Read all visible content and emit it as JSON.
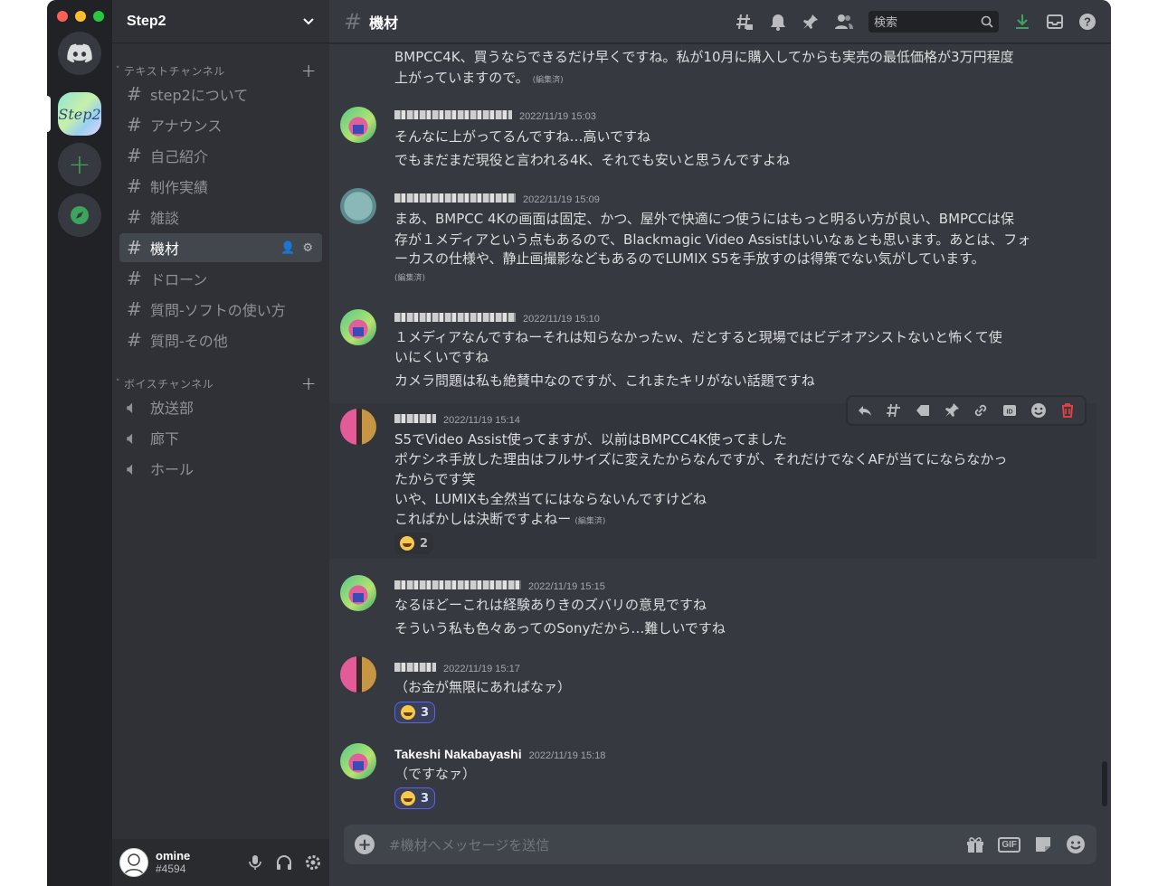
{
  "app": {
    "server_name": "Step2",
    "server_icon_text": "Step2"
  },
  "categories": {
    "text": "テキストチャンネル",
    "voice": "ボイスチャンネル"
  },
  "channels": [
    {
      "name": "step2について"
    },
    {
      "name": "アナウンス"
    },
    {
      "name": "自己紹介"
    },
    {
      "name": "制作実績"
    },
    {
      "name": "雑談"
    },
    {
      "name": "機材"
    },
    {
      "name": "ドローン"
    },
    {
      "name": "質問-ソフトの使い方"
    },
    {
      "name": "質問-その他"
    }
  ],
  "voice_channels": [
    {
      "name": "放送部"
    },
    {
      "name": "廊下"
    },
    {
      "name": "ホール"
    }
  ],
  "user": {
    "name": "omine",
    "tag": "#4594"
  },
  "topbar": {
    "channel": "機材",
    "search_placeholder": "検索"
  },
  "messages": [
    {
      "lines": [
        "BMPCC4K、買うならできるだけ早くですね。私が10月に購入してからも実売の最低価格が3万円程度",
        "上がっていますので。"
      ],
      "edited": "(編集済)"
    },
    {
      "time": "2022/11/19 15:03",
      "lines": [
        "そんなに上がってるんですね…高いですね",
        "でもまだまだ現役と言われる4K、それでも安いと思うんですよね"
      ]
    },
    {
      "time": "2022/11/19 15:09",
      "lines": [
        "まあ、BMPCC 4Kの画面は固定、かつ、屋外で快適につ使うにはもっと明るい方が良い、BMPCCは保",
        "存が１メディアという点もあるので、Blackmagic Video Assistはいいなぁとも思います。あとは、フォ",
        "ーカスの仕様や、静止画撮影などもあるのでLUMIX S5を手放すのは得策でない気がしています。"
      ],
      "edited": "(編集済)"
    },
    {
      "time": "2022/11/19 15:10",
      "lines": [
        "１メディアなんですねーそれは知らなかったｗ、だとすると現場ではビデオアシストないと怖くて使",
        "いにくいですね",
        "カメラ問題は私も絶賛中なのですが、これまたキリがない話題ですね"
      ]
    },
    {
      "time": "2022/11/19 15:14",
      "lines": [
        "S5でVideo Assist使ってますが、以前はBMPCC4K使ってました",
        "ポケシネ手放した理由はフルサイズに変えたからなんですが、それだけでなくAFが当てにならなかっ",
        "たからです笑",
        "いや、LUMIXも全然当てにはならないんですけどね",
        "こればかしは決断ですよねー"
      ],
      "edited": "(編集済)",
      "reaction": "2"
    },
    {
      "time": "2022/11/19 15:15",
      "lines": [
        "なるほどーこれは経験ありきのズバリの意見ですね",
        "そういう私も色々あってのSonyだから…難しいですね"
      ]
    },
    {
      "time": "2022/11/19 15:17",
      "lines": [
        "（お金が無限にあればなァ）"
      ],
      "reaction": "3"
    },
    {
      "author": "Takeshi Nakabayashi",
      "time": "2022/11/19 15:18",
      "lines": [
        "（ですなァ）"
      ],
      "reaction": "3"
    }
  ],
  "composer": {
    "placeholder": "#機材へメッセージを送信"
  },
  "colors": {
    "accent": "#5865f2",
    "green": "#3ba55d",
    "danger": "#ed4245"
  }
}
